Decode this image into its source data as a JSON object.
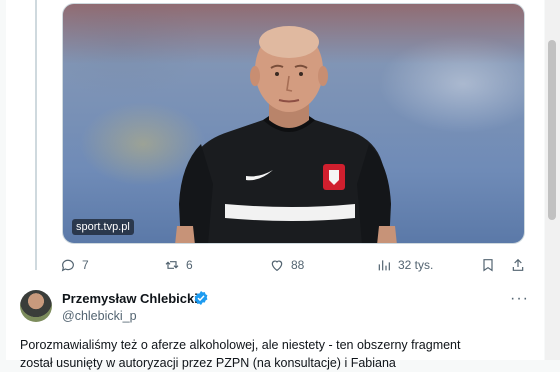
{
  "media": {
    "watermark": "sport.tvp.pl",
    "description_icon": "photo"
  },
  "actions": {
    "reply_count": "7",
    "retweet_count": "6",
    "like_count": "88",
    "views_count": "32 tys.",
    "icons": [
      "reply-icon",
      "retweet-icon",
      "like-icon",
      "views-icon",
      "bookmark-icon",
      "share-icon"
    ]
  },
  "tweet": {
    "author_name": "Przemysław Chlebicki",
    "handle": "@chlebicki_p",
    "more_label": "···",
    "text_line1": "Porozmawialiśmy też o aferze alkoholowej, ale niestety - ten obszerny fragment",
    "text_line2": "został usunięty w autoryzacji przez PZPN (na konsultacje) i Fabiana"
  },
  "colors": {
    "accent_blue": "#1d9bf0",
    "muted": "#536471",
    "text": "#0f1419",
    "divider": "#cfd9de"
  }
}
